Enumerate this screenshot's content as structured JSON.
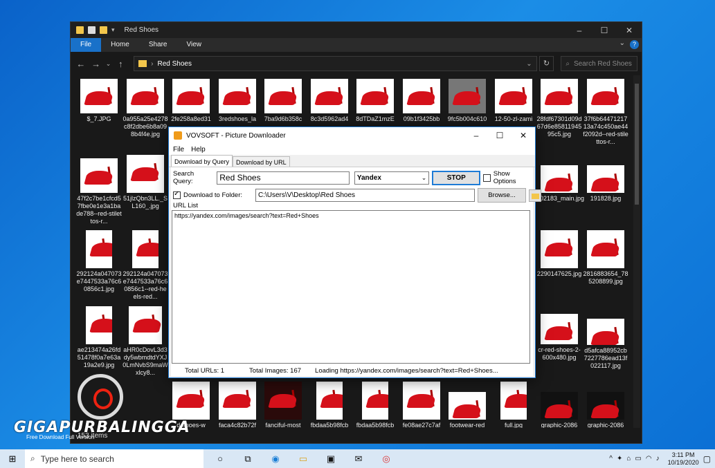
{
  "explorer": {
    "title": "Red Shoes",
    "ribbon_tabs": [
      "File",
      "Home",
      "Share",
      "View"
    ],
    "path": "Red Shoes",
    "search_placeholder": "Search Red Shoes",
    "status": "153 items",
    "files": [
      {
        "name": "$_7.JPG"
      },
      {
        "name": "0a955a25e4278c8f2dbe6b8a098b4f4e.jpg"
      },
      {
        "name": "2fe258a8ed31"
      },
      {
        "name": "3redshoes_la"
      },
      {
        "name": "7ba9d6b358c"
      },
      {
        "name": "8c3d5962ad4"
      },
      {
        "name": "8dTDaZ1mzE"
      },
      {
        "name": "09b1f3425bb"
      },
      {
        "name": "9fc5b004c610"
      },
      {
        "name": "12-50-zl-zami"
      },
      {
        "name": "28fdf67301d09d67d6e8581194595c5.jpg"
      },
      {
        "name": "37f6b6447121713a74c450ae44f2092d--red-stilettos-r..."
      },
      {
        "name": "47f2c7be1cfcd57fbe0e1e3a1bade788--red-stilettos-r..."
      },
      {
        "name": "51jlzQbn3LL._SL160_.jpg"
      },
      {
        "name": "102183_main.jpg"
      },
      {
        "name": "191828.jpg"
      },
      {
        "name": "292124a047073e7447533a76c60856c1.jpg"
      },
      {
        "name": "292124a047073e7447533a76c60856c1--red-heels-red..."
      },
      {
        "name": "2290147625.jpg"
      },
      {
        "name": "2816883654_785208899.jpg"
      },
      {
        "name": "ae213474a26fd51478f0a7e63a19a2e9.jpg"
      },
      {
        "name": "aHR0cDovL3d3dy5wbmdtdYXJ0LmNvbS9maWxlcy8..."
      },
      {
        "name": "cr-red-shoes-2-600x480.jpg"
      },
      {
        "name": "d5afca88952cb7227786ead13f022117.jpg"
      },
      {
        "name": "d-shoes-w"
      },
      {
        "name": "faca4c82b72f"
      },
      {
        "name": "fanciful-most"
      },
      {
        "name": "fbdaa5b98fcb"
      },
      {
        "name": "fbdaa5b98fcb"
      },
      {
        "name": "fe08ae27c7af"
      },
      {
        "name": "footwear-red"
      },
      {
        "name": "full.jpg"
      },
      {
        "name": "graphic-2086"
      },
      {
        "name": "graphic-2086"
      }
    ]
  },
  "downloader": {
    "title": "VOVSOFT - Picture Downloader",
    "menu": [
      "File",
      "Help"
    ],
    "tabs": [
      "Download by Query",
      "Download by URL"
    ],
    "search_query_label": "Search Query:",
    "search_query_value": "Red Shoes",
    "engine": "Yandex",
    "stop_label": "STOP",
    "show_options_label": "Show Options",
    "download_folder_label": "Download to Folder:",
    "folder_path": "C:\\Users\\V\\Desktop\\Red Shoes",
    "browse_label": "Browse...",
    "url_list_label": "URL List",
    "url_list": "https://yandex.com/images/search?text=Red+Shoes",
    "status": {
      "total_urls": "Total URLs: 1",
      "total_images": "Total Images: 167",
      "loading": "Loading https://yandex.com/images/search?text=Red+Shoes..."
    }
  },
  "watermark": {
    "brand": "GIGAPURBALINGGA",
    "sub": "Free Download Full Version"
  },
  "taskbar": {
    "search_placeholder": "Type here to search",
    "time": "3:11 PM",
    "date": "10/19/2020"
  }
}
